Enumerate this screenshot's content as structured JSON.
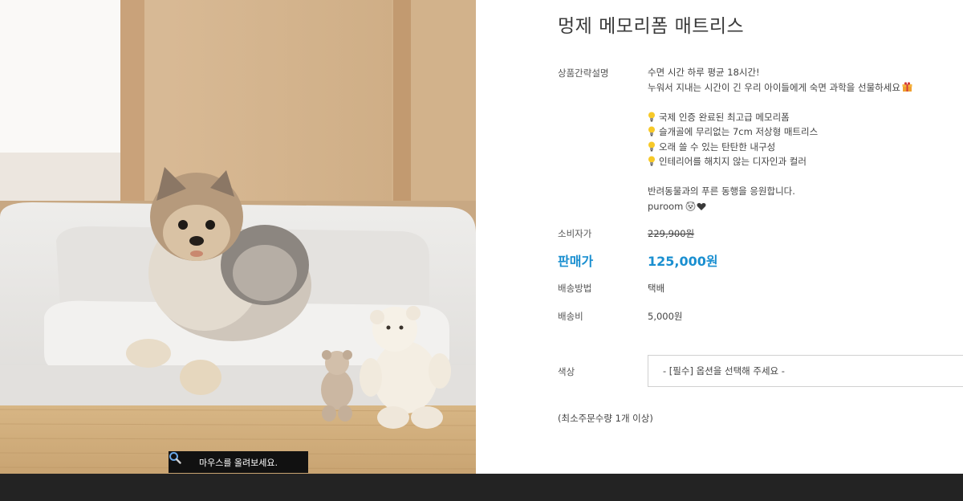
{
  "product": {
    "title": "멍제 메모리폼 매트리스"
  },
  "image": {
    "zoom_hint": "마우스를 올려보세요.",
    "icon": "magnifier-icon"
  },
  "summary": {
    "label": "상품간략설명",
    "line1": "수면 시간 하루 평균 18시간!",
    "line2": "누워서 지내는 시간이 긴 우리 아이들에게 숙면 과학을 선물하세요",
    "features": [
      "국제 인증 완료된 최고급 메모리폼",
      "슬개골에 무리없는 7cm 저상형 매트리스",
      "오래 쓸 수 있는 탄탄한 내구성",
      "인테리어를 해치지 않는 디자인과 컬러"
    ],
    "closing1": "반려동물과의 푸른 동행을 응원합니다.",
    "closing2": "puroom"
  },
  "pricing": {
    "consumer_label": "소비자가",
    "consumer_price": "229,900원",
    "sale_label": "판매가",
    "sale_price": "125,000원",
    "shipping_method_label": "배송방법",
    "shipping_method": "택배",
    "shipping_fee_label": "배송비",
    "shipping_fee": "5,000원"
  },
  "options": {
    "color_label": "색상",
    "color_select": "- [필수] 옵션을 선택해 주세요 -"
  },
  "min_order": "(최소주문수량 1개 이상)",
  "colors": {
    "accent": "#1a8fd0",
    "bottom_bar": "#232323"
  }
}
